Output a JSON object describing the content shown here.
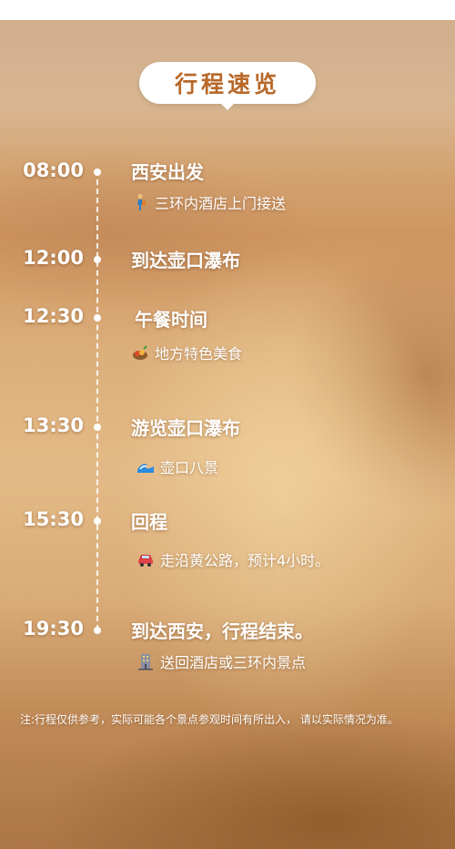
{
  "title": "行程速览",
  "schedule": [
    {
      "time": "08:00",
      "title": "西安出发",
      "sub": "三环内酒店上门接送",
      "icon": "person-walking-icon"
    },
    {
      "time": "12:00",
      "title": "到达壶口瀑布",
      "sub": "",
      "icon": ""
    },
    {
      "time": "12:30",
      "title": "午餐时间",
      "sub": "地方特色美食",
      "icon": "food-icon"
    },
    {
      "time": "13:30",
      "title": "游览壶口瀑布",
      "sub": "壶口八景",
      "icon": "wave-icon"
    },
    {
      "time": "15:30",
      "title": "回程",
      "sub": "走沿黄公路，预计4小时。",
      "icon": "car-icon"
    },
    {
      "time": "19:30",
      "title": "到达西安，行程结束。",
      "sub": "送回酒店或三环内景点",
      "icon": "building-icon"
    }
  ],
  "note": "注:行程仅供参考，实际可能各个景点参观时间有所出入，  请以实际情况为准。",
  "colors": {
    "accent": "#b8692a",
    "text": "#ffffff",
    "background": "#d9aa74"
  }
}
